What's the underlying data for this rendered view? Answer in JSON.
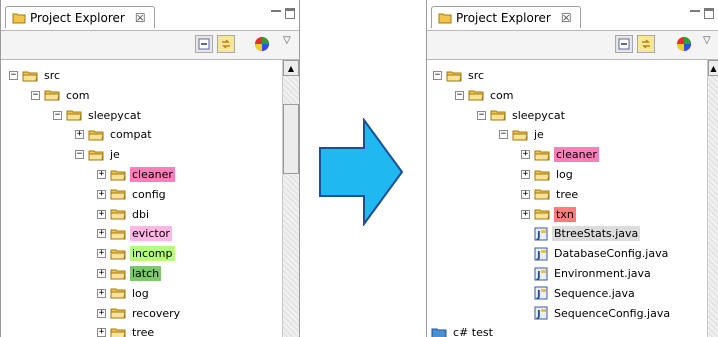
{
  "left_panel": {
    "title": "Project Explorer",
    "close_symbol": "☒",
    "rows": [
      {
        "label": "src",
        "icon": "folder-icon",
        "toggle": "−"
      },
      {
        "label": "com",
        "icon": "folder-icon",
        "toggle": "−"
      },
      {
        "label": "sleepycat",
        "icon": "folder-icon",
        "toggle": "−"
      },
      {
        "label": "compat",
        "icon": "folder-icon",
        "toggle": "+"
      },
      {
        "label": "je",
        "icon": "folder-icon",
        "toggle": "−"
      },
      {
        "label": "cleaner",
        "icon": "folder-icon",
        "toggle": "+",
        "highlight": "#ff7eb9"
      },
      {
        "label": "config",
        "icon": "folder-icon",
        "toggle": "+"
      },
      {
        "label": "dbi",
        "icon": "folder-icon",
        "toggle": "+"
      },
      {
        "label": "evictor",
        "icon": "folder-icon",
        "toggle": "+",
        "highlight": "#ffb8e5"
      },
      {
        "label": "incomp",
        "icon": "folder-icon",
        "toggle": "+",
        "highlight": "#b6ff7a"
      },
      {
        "label": "latch",
        "icon": "folder-icon",
        "toggle": "+",
        "highlight": "#7ac96a"
      },
      {
        "label": "log",
        "icon": "folder-icon",
        "toggle": "+"
      },
      {
        "label": "recovery",
        "icon": "folder-icon",
        "toggle": "+"
      },
      {
        "label": "tree",
        "icon": "folder-icon",
        "toggle": "+"
      }
    ]
  },
  "right_panel": {
    "title": "Project Explorer",
    "close_symbol": "☒",
    "rows": [
      {
        "label": "src",
        "icon": "folder-icon",
        "toggle": "−"
      },
      {
        "label": "com",
        "icon": "folder-icon",
        "toggle": "−"
      },
      {
        "label": "sleepycat",
        "icon": "folder-icon",
        "toggle": "−"
      },
      {
        "label": "je",
        "icon": "folder-icon",
        "toggle": "−"
      },
      {
        "label": "cleaner",
        "icon": "folder-icon",
        "toggle": "+",
        "highlight": "#ff7eb9"
      },
      {
        "label": "log",
        "icon": "folder-icon",
        "toggle": "+"
      },
      {
        "label": "tree",
        "icon": "folder-icon",
        "toggle": "+"
      },
      {
        "label": "txn",
        "icon": "folder-icon",
        "toggle": "+",
        "highlight": "#ff7c7c"
      },
      {
        "label": "BtreeStats.java",
        "icon": "java-file-icon",
        "highlight": "#dcdcdc"
      },
      {
        "label": "DatabaseConfig.java",
        "icon": "java-file-icon"
      },
      {
        "label": "Environment.java",
        "icon": "java-file-icon"
      },
      {
        "label": "Sequence.java",
        "icon": "java-file-icon"
      },
      {
        "label": "SequenceConfig.java",
        "icon": "java-file-icon"
      }
    ],
    "project": {
      "label": "c# test",
      "icon": "project-folder-icon"
    }
  },
  "colors": {
    "folder": "#f3c44a",
    "arrow_fill": "#1fb8f0",
    "arrow_stroke": "#1a4f9a"
  }
}
